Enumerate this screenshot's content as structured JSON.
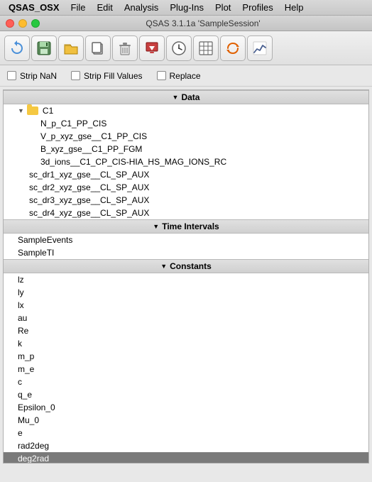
{
  "menubar": {
    "app": "QSAS_OSX",
    "items": [
      "File",
      "Edit",
      "Analysis",
      "Plug-Ins",
      "Plot",
      "Profiles",
      "Help"
    ]
  },
  "windowTitle": "QSAS 3.1.1a  'SampleSession'",
  "toolbar": {
    "buttons": [
      {
        "name": "refresh-btn",
        "icon": "↺"
      },
      {
        "name": "save-btn",
        "icon": "💾"
      },
      {
        "name": "open-btn",
        "icon": "📂"
      },
      {
        "name": "copy-btn",
        "icon": "📋"
      },
      {
        "name": "delete-btn",
        "icon": "🗑"
      },
      {
        "name": "import-btn",
        "icon": "📥"
      },
      {
        "name": "clock-btn",
        "icon": "⏱"
      },
      {
        "name": "table-btn",
        "icon": "⊞"
      },
      {
        "name": "loop-btn",
        "icon": "⇄"
      },
      {
        "name": "chart-btn",
        "icon": "📈"
      }
    ]
  },
  "options": {
    "stripNaN": {
      "label": "Strip NaN",
      "checked": false
    },
    "stripFill": {
      "label": "Strip Fill Values",
      "checked": false
    },
    "replace": {
      "label": "Replace",
      "checked": false
    }
  },
  "sections": {
    "data": {
      "label": "Data",
      "expanded": true,
      "tree": {
        "c1": {
          "label": "C1",
          "children": [
            "N_p_C1_PP_CIS",
            "V_p_xyz_gse__C1_PP_CIS",
            "B_xyz_gse__C1_PP_FGM",
            "3d_ions__C1_CP_CIS-HIA_HS_MAG_IONS_RC",
            "sc_dr1_xyz_gse__CL_SP_AUX",
            "sc_dr2_xyz_gse__CL_SP_AUX",
            "sc_dr3_xyz_gse__CL_SP_AUX",
            "sc_dr4_xyz_gse__CL_SP_AUX"
          ]
        }
      }
    },
    "timeIntervals": {
      "label": "Time Intervals",
      "expanded": true,
      "items": [
        "SampleEvents",
        "SampleTI"
      ]
    },
    "constants": {
      "label": "Constants",
      "expanded": true,
      "items": [
        "lz",
        "ly",
        "lx",
        "au",
        "Re",
        "k",
        "m_p",
        "m_e",
        "c",
        "q_e",
        "Epsilon_0",
        "Mu_0",
        "e",
        "rad2deg",
        "deg2rad"
      ]
    }
  },
  "selectedItem": "deg2rad"
}
